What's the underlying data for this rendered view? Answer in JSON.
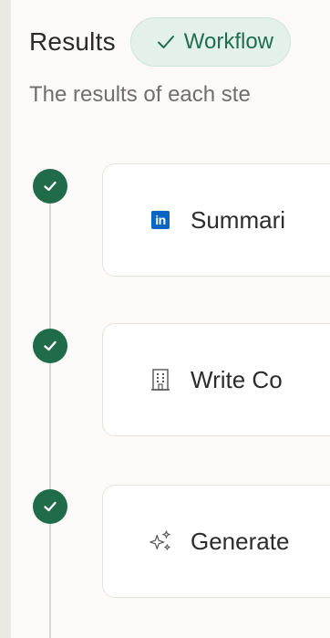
{
  "header": {
    "title": "Results",
    "badge_label": "Workflow"
  },
  "subtitle": "The results of each ste",
  "steps": [
    {
      "label": "Summari",
      "icon": "linkedin-icon",
      "status": "completed"
    },
    {
      "label": "Write Co",
      "icon": "building-icon",
      "status": "completed"
    },
    {
      "label": "Generate",
      "icon": "sparkles-icon",
      "status": "completed"
    }
  ],
  "icon_text": {
    "linkedin": "in"
  },
  "colors": {
    "accent_green": "#1f6b4a",
    "badge_bg": "#e3f1ea",
    "badge_text": "#1f6e4f",
    "linkedin_blue": "#0a66c2"
  }
}
